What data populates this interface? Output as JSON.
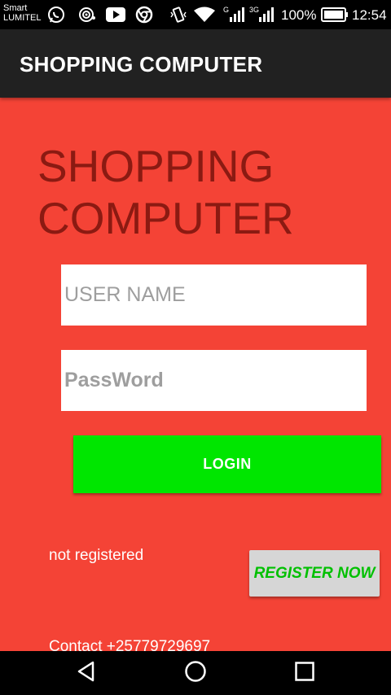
{
  "status_bar": {
    "carrier_line1": "Smart",
    "carrier_line2": "LUMITEL",
    "battery_percent": "100%",
    "time": "12:54",
    "icons": [
      "whatsapp-icon",
      "radio-icon",
      "youtube-icon",
      "chrome-icon",
      "vibrate-icon",
      "wifi-icon",
      "signal-g-icon",
      "signal-3g-icon",
      "battery-icon"
    ]
  },
  "app_bar": {
    "title": "SHOPPING COMPUTER"
  },
  "main": {
    "hero_title": "SHOPPING COMPUTER",
    "username_placeholder": "USER NAME",
    "password_placeholder": "PassWord",
    "login_label": "LOGIN",
    "not_registered_text": "not registered",
    "register_label": "REGISTER NOW",
    "contact_text": "Contact +25779729697"
  },
  "nav_bar": {
    "icons": [
      "back-icon",
      "home-icon",
      "recents-icon"
    ]
  },
  "colors": {
    "background": "#f44336",
    "app_bar": "#212121",
    "hero_text": "#8b1a12",
    "login_button": "#00e600",
    "register_button_bg": "#d6d6d6",
    "register_button_text": "#00c000"
  }
}
